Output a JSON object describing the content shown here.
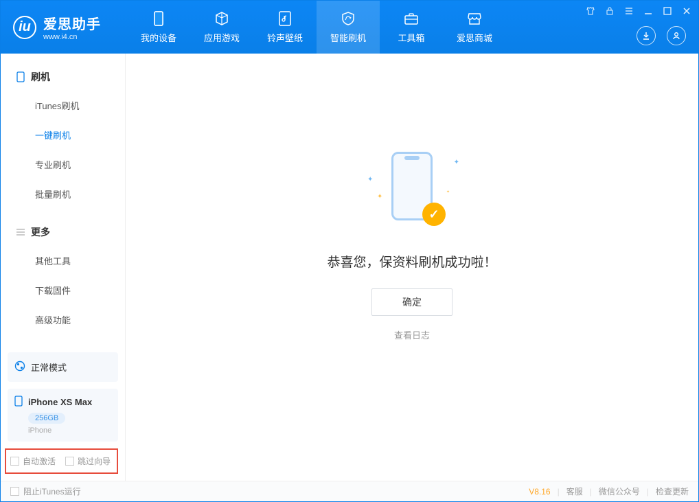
{
  "app": {
    "title": "爱思助手",
    "subtitle": "www.i4.cn"
  },
  "nav": {
    "tabs": [
      {
        "label": "我的设备"
      },
      {
        "label": "应用游戏"
      },
      {
        "label": "铃声壁纸"
      },
      {
        "label": "智能刷机"
      },
      {
        "label": "工具箱"
      },
      {
        "label": "爱思商城"
      }
    ],
    "active_index": 3
  },
  "sidebar": {
    "sections": [
      {
        "title": "刷机",
        "items": [
          {
            "label": "iTunes刷机"
          },
          {
            "label": "一键刷机"
          },
          {
            "label": "专业刷机"
          },
          {
            "label": "批量刷机"
          }
        ],
        "active_index": 1
      },
      {
        "title": "更多",
        "items": [
          {
            "label": "其他工具"
          },
          {
            "label": "下载固件"
          },
          {
            "label": "高级功能"
          }
        ]
      }
    ],
    "mode_label": "正常模式",
    "device": {
      "name": "iPhone XS Max",
      "storage": "256GB",
      "type": "iPhone"
    },
    "checks": {
      "auto_activate": "自动激活",
      "skip_guide": "跳过向导"
    }
  },
  "main": {
    "success_text": "恭喜您，保资料刷机成功啦！",
    "ok_button": "确定",
    "view_log": "查看日志"
  },
  "footer": {
    "block_itunes": "阻止iTunes运行",
    "version": "V8.16",
    "support": "客服",
    "wechat": "微信公众号",
    "check_update": "检查更新"
  }
}
